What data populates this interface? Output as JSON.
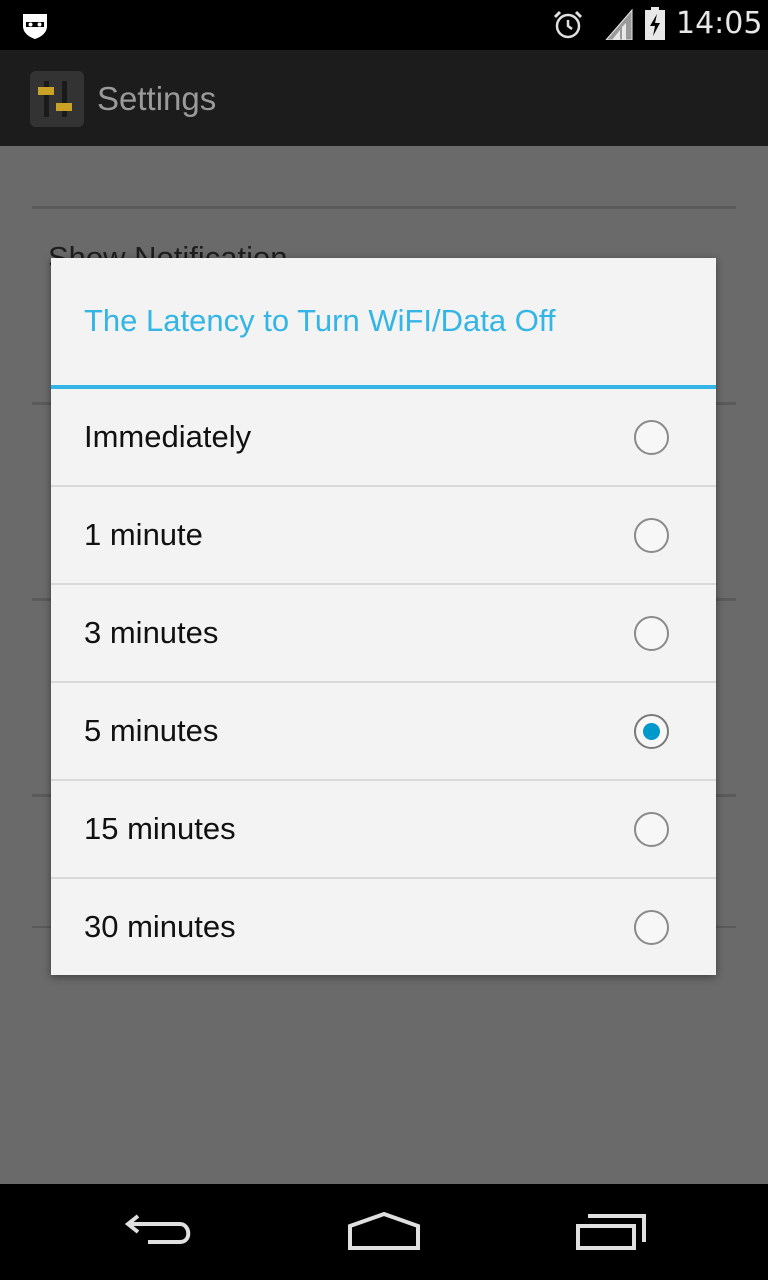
{
  "status_bar": {
    "time": "14:05",
    "icons": [
      "incognito-icon",
      "alarm-icon",
      "signal-icon",
      "battery-charging-icon"
    ]
  },
  "action_bar": {
    "title": "Settings",
    "icon": "settings-app-icon"
  },
  "background_settings": {
    "first_item_title": "Show Notification"
  },
  "dialog": {
    "title": "The Latency to Turn WiFI/Data Off",
    "accent_color": "#33b5e5",
    "selected_index": 3,
    "options": [
      {
        "label": "Immediately",
        "selected": false
      },
      {
        "label": "1 minute",
        "selected": false
      },
      {
        "label": "3 minutes",
        "selected": false
      },
      {
        "label": "5 minutes",
        "selected": true
      },
      {
        "label": "15 minutes",
        "selected": false
      },
      {
        "label": "30 minutes",
        "selected": false
      }
    ]
  },
  "nav_bar": {
    "buttons": [
      "back-icon",
      "home-icon",
      "recents-icon"
    ]
  }
}
